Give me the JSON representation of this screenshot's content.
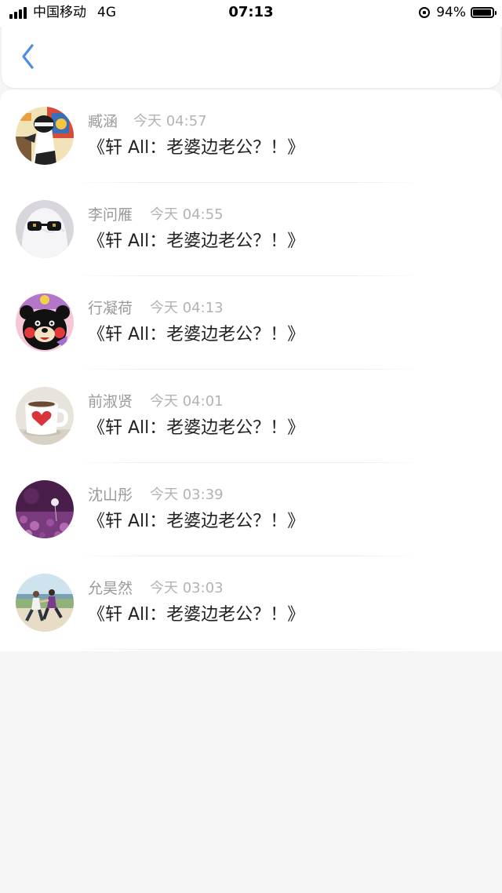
{
  "status_bar": {
    "carrier": "中国移动",
    "network": "4G",
    "time": "07:13",
    "battery": "94%",
    "battery_level": 0.94
  },
  "header": {
    "back_icon": "chevron-left-icon",
    "accent_color": "#4a90e2"
  },
  "messages": [
    {
      "name": "臧涵",
      "time": "今天 04:57",
      "text": "《轩 All：老婆边老公？！》",
      "avatar": "cartoon-figure"
    },
    {
      "name": "李问雁",
      "time": "今天 04:55",
      "text": "《轩 All：老婆边老公？！》",
      "avatar": "ghost-sunglasses"
    },
    {
      "name": "行凝荷",
      "time": "今天 04:13",
      "text": "《轩 All：老婆边老公？！》",
      "avatar": "black-bear"
    },
    {
      "name": "前淑贤",
      "time": "今天 04:01",
      "text": "《轩 All：老婆边老公？！》",
      "avatar": "heart-mug"
    },
    {
      "name": "沈山彤",
      "time": "今天 03:39",
      "text": "《轩 All：老婆边老公？！》",
      "avatar": "purple-flowers"
    },
    {
      "name": "允昊然",
      "time": "今天 03:03",
      "text": "《轩 All：老婆边老公？！》",
      "avatar": "running-couple"
    }
  ]
}
